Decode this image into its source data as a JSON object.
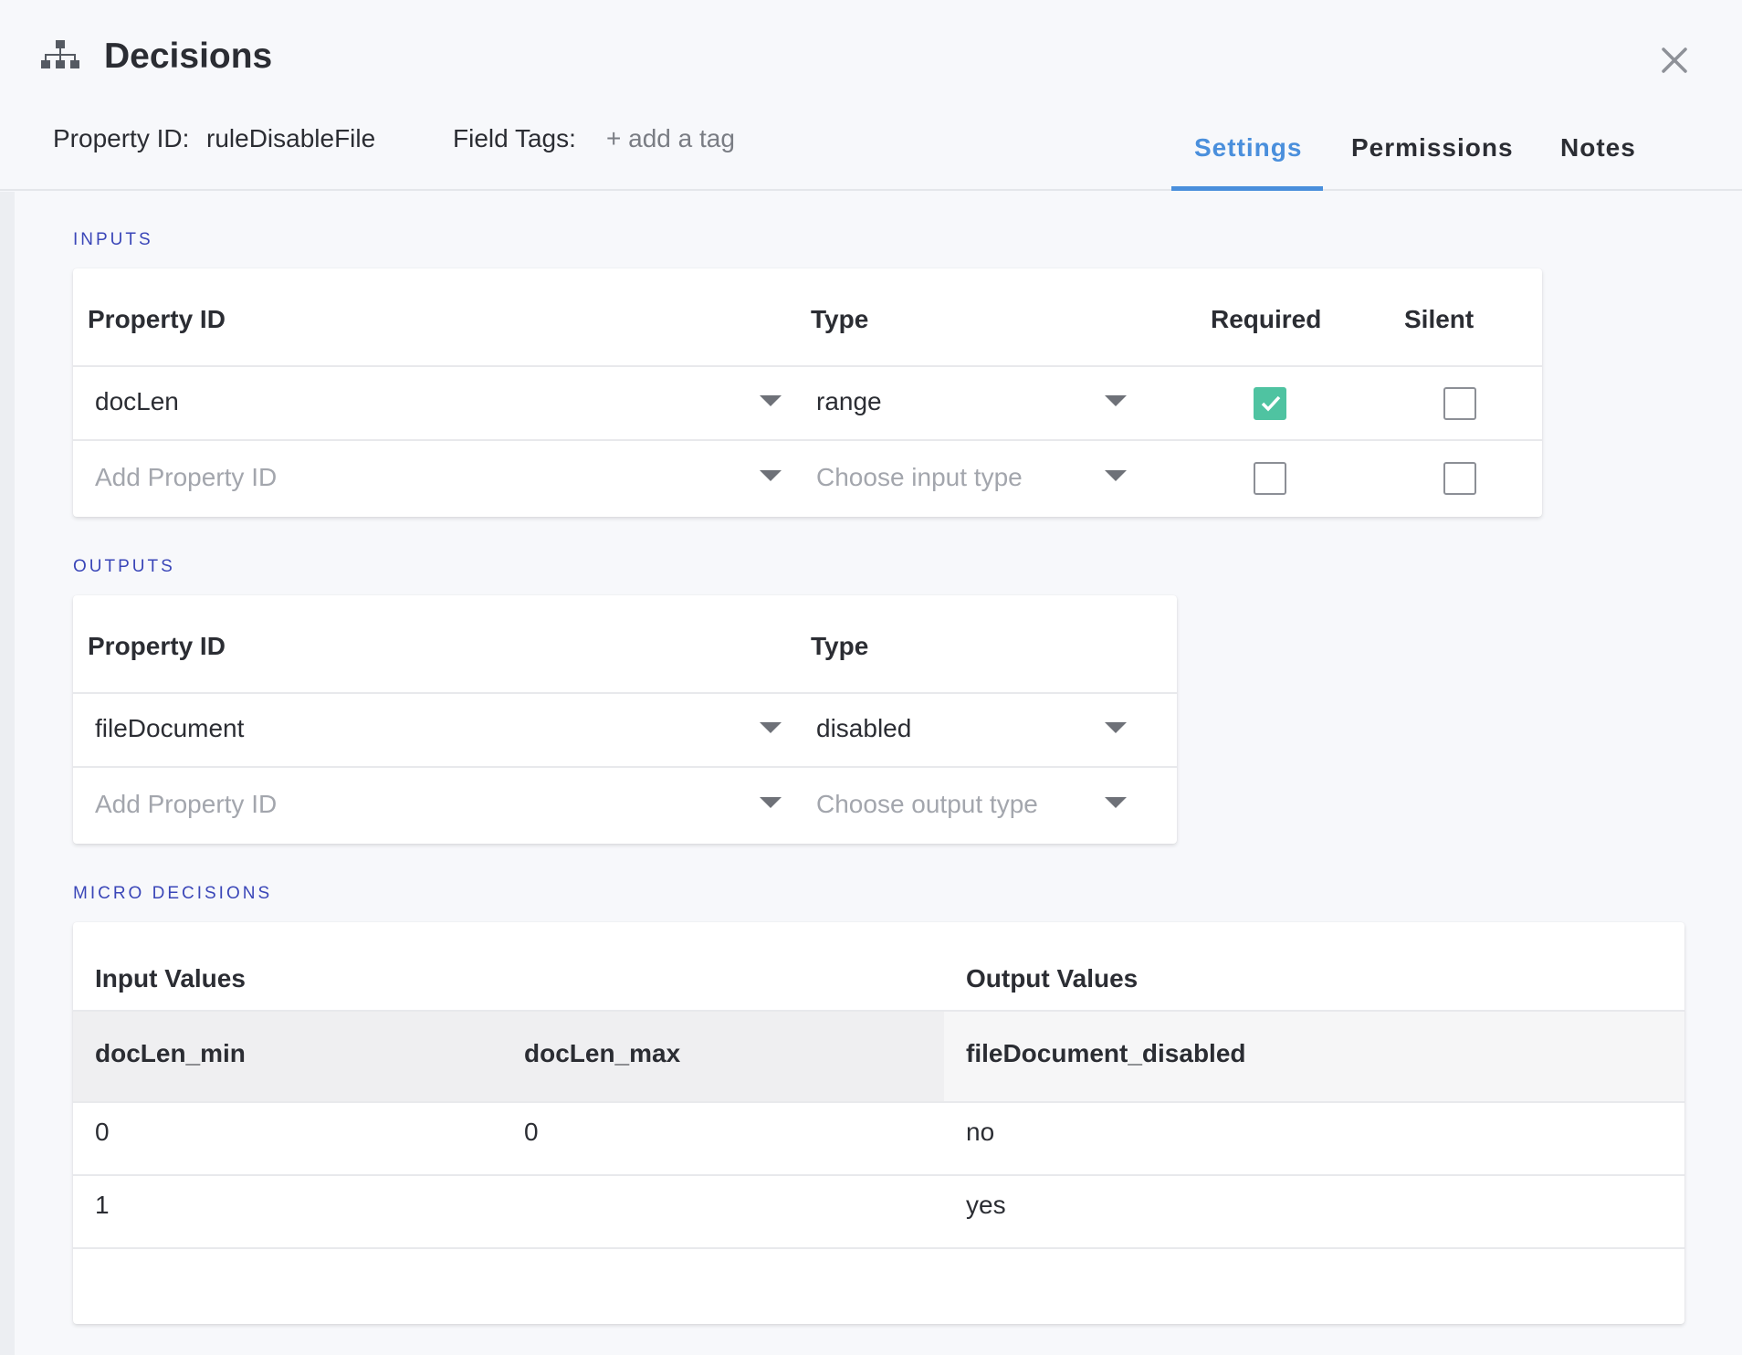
{
  "modal": {
    "title": "Decisions",
    "title_icon": "sitemap-icon",
    "close_icon": "close-icon"
  },
  "meta": {
    "property_id_label": "Property ID:",
    "property_id_value": "ruleDisableFile",
    "field_tags_label": "Field Tags:",
    "add_tag_label": "+ add a tag"
  },
  "tabs": [
    {
      "label": "Settings",
      "active": true
    },
    {
      "label": "Permissions",
      "active": false
    },
    {
      "label": "Notes",
      "active": false
    }
  ],
  "inputs": {
    "section_label": "INPUTS",
    "headers": {
      "property_id": "Property ID",
      "type": "Type",
      "required": "Required",
      "silent": "Silent"
    },
    "rows": [
      {
        "property_id": "docLen",
        "type": "range",
        "required": true,
        "silent": false
      },
      {
        "property_id_placeholder": "Add Property ID",
        "type_placeholder": "Choose input type",
        "required": false,
        "silent": false
      }
    ]
  },
  "outputs": {
    "section_label": "OUTPUTS",
    "headers": {
      "property_id": "Property ID",
      "type": "Type"
    },
    "rows": [
      {
        "property_id": "fileDocument",
        "type": "disabled"
      },
      {
        "property_id_placeholder": "Add Property ID",
        "type_placeholder": "Choose output type"
      }
    ]
  },
  "micro_decisions": {
    "section_label": "MICRO DECISIONS",
    "group_headers": {
      "input_values": "Input Values",
      "output_values": "Output Values"
    },
    "columns": [
      "docLen_min",
      "docLen_max",
      "fileDocument_disabled"
    ],
    "rows": [
      [
        "0",
        "0",
        "no"
      ],
      [
        "1",
        "",
        "yes"
      ]
    ]
  },
  "colors": {
    "accent": "#4a8fdc",
    "section_label": "#3a46b8",
    "checkbox_checked": "#4fc3a1"
  }
}
